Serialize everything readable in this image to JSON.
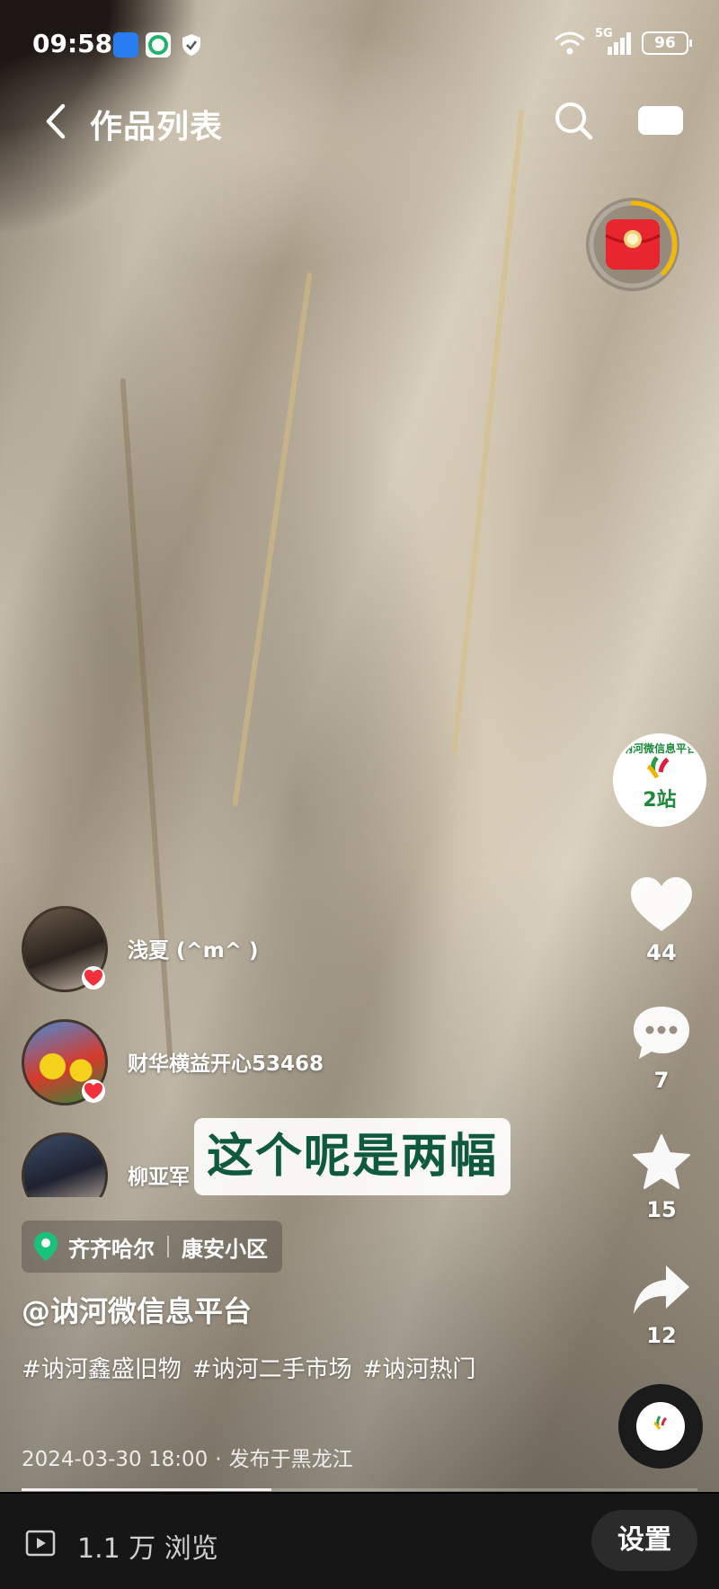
{
  "status_bar": {
    "time": "09:58",
    "network": "5G",
    "battery": "96"
  },
  "nav": {
    "title": "作品列表"
  },
  "right_rail": {
    "account_badge_title": "讷河微信息平台",
    "account_badge_sub": "2站",
    "likes": "44",
    "comments": "7",
    "favorites": "15",
    "shares": "12"
  },
  "viewers": [
    {
      "name": "浅夏 (^m^ )"
    },
    {
      "name": "财华横益开心53468"
    },
    {
      "name": "柳亚军"
    }
  ],
  "subtitle": "这个呢是两幅",
  "location": {
    "city": "齐齐哈尔",
    "place": "康安小区"
  },
  "author": "@讷河微信息平台",
  "hashtags": [
    "#讷河鑫盛旧物",
    "#讷河二手市场",
    "#讷河热门"
  ],
  "post": {
    "datetime": "2024-03-30 18:00",
    "region": "发布于黑龙江"
  },
  "progress": 0.37,
  "bottom_bar": {
    "view_count": "1.1 万 浏览",
    "settings_label": "设置"
  },
  "colors": {
    "subtitle_text": "#0f5a3e",
    "location_pin": "#19c27a",
    "heart_red": "#f0303c",
    "red_packet": "#e8262f",
    "timer_ring": "#f5b800"
  }
}
